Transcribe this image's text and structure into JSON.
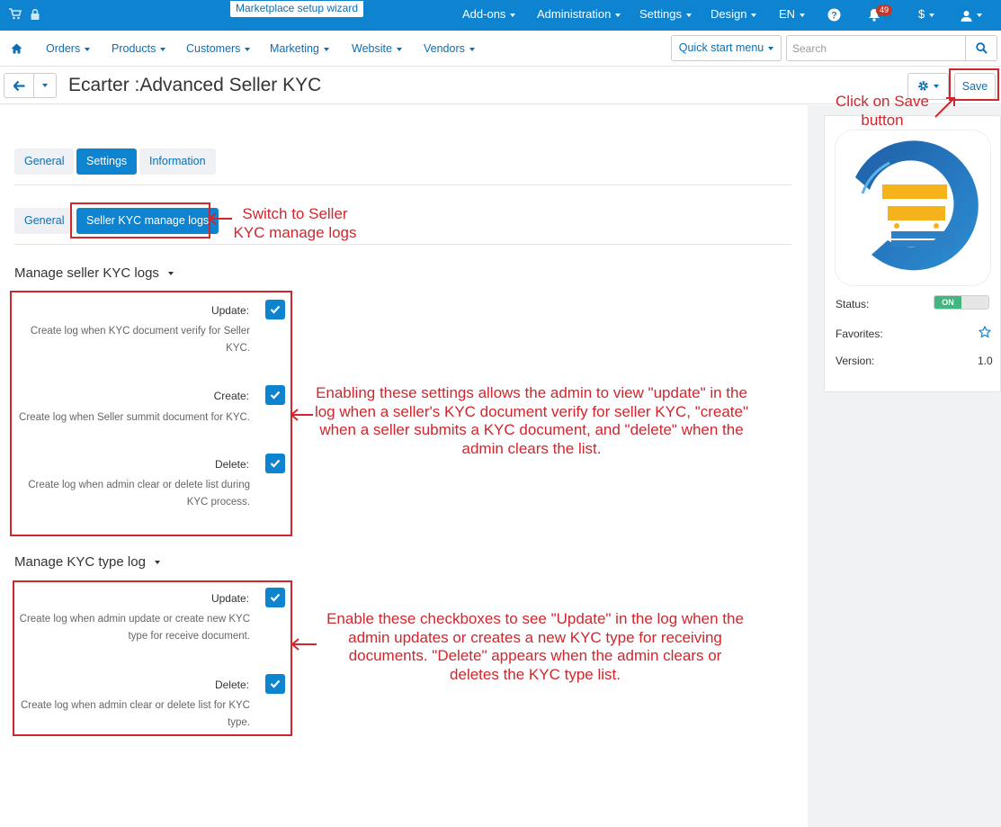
{
  "topbar": {
    "wizard_label": "Marketplace setup wizard",
    "menus": [
      "Add-ons",
      "Administration",
      "Settings",
      "Design",
      "EN"
    ],
    "notifications_count": "49",
    "currency": "$"
  },
  "nav": {
    "items": [
      "Orders",
      "Products",
      "Customers",
      "Marketing",
      "Website",
      "Vendors"
    ],
    "quick_start": "Quick start menu",
    "search_placeholder": "Search"
  },
  "header": {
    "title": "Ecarter :Advanced Seller KYC",
    "save_label": "Save"
  },
  "tabs": [
    "General",
    "Settings",
    "Information"
  ],
  "subtabs": [
    "General",
    "Seller KYC manage logs"
  ],
  "seller_logs": {
    "title": "Manage seller KYC logs",
    "fields": [
      {
        "label": "Update:",
        "desc": "Create log when KYC document verify for Seller KYC.",
        "checked": true
      },
      {
        "label": "Create:",
        "desc": "Create log when Seller summit document for KYC.",
        "checked": true
      },
      {
        "label": "Delete:",
        "desc": "Create log when admin clear or delete list during KYC process.",
        "checked": true
      }
    ]
  },
  "type_logs": {
    "title": "Manage KYC type log",
    "fields": [
      {
        "label": "Update:",
        "desc": "Create log when admin update or create new KYC type for receive document.",
        "checked": true
      },
      {
        "label": "Delete:",
        "desc": "Create log when admin clear or delete list for KYC type.",
        "checked": true
      }
    ]
  },
  "sidebar": {
    "status_label": "Status:",
    "status_value": "ON",
    "favorites_label": "Favorites:",
    "version_label": "Version:",
    "version_value": "1.0"
  },
  "annotations": {
    "save": "Click on Save button",
    "switch": "Switch to Seller KYC manage logs",
    "seller": "Enabling these settings allows the admin to view \"update\" in the log when a seller's KYC document verify for seller KYC, \"create\" when a seller submits a KYC document, and \"delete\" when the admin clears the list.",
    "type": "Enable these checkboxes to see \"Update\" in the log when the admin updates or creates a new KYC type for receiving documents. \"Delete\" appears when the admin clears or deletes the KYC type list."
  },
  "colors": {
    "primary": "#0e84d0",
    "annotation_red": "#d0262d",
    "status_on": "#43b581"
  },
  "icons": [
    "cart-icon",
    "lock-icon",
    "help-icon",
    "bell-icon",
    "user-icon",
    "home-icon",
    "search-icon",
    "back-arrow-icon",
    "gear-icon",
    "star-icon",
    "check-icon"
  ]
}
